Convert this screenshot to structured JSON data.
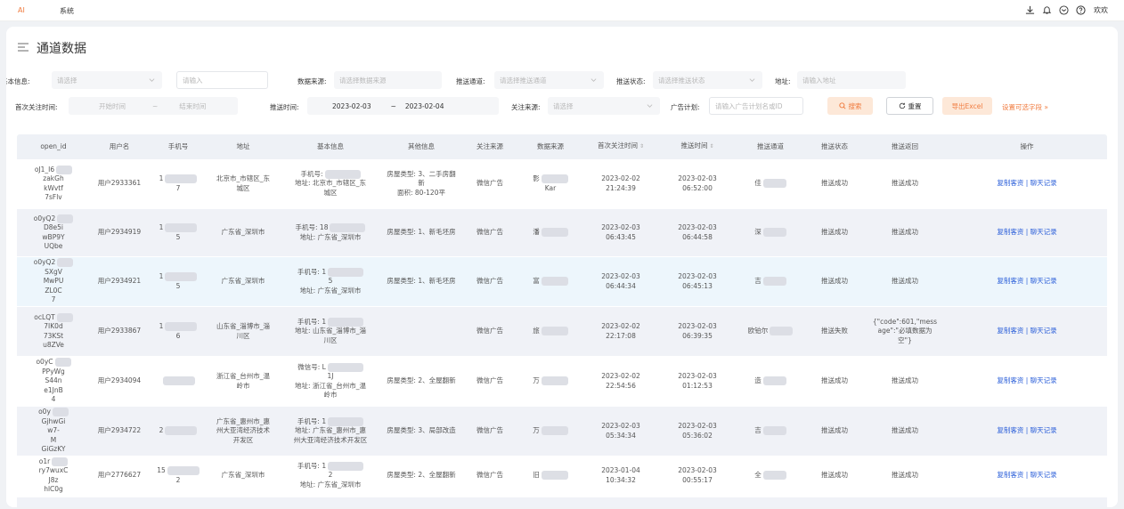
{
  "topbar": {
    "ai_tab": "AI",
    "system_tab": "系统",
    "user": "欢欢",
    "icons": [
      "download-icon",
      "bell-icon",
      "mail-icon",
      "help-icon"
    ]
  },
  "page": {
    "title": "通道数据"
  },
  "filters": {
    "basic_info_label": "基本信息:",
    "basic_info_select": "请选择",
    "basic_info_input": "请输入",
    "data_source_label": "数据来源:",
    "data_source_placeholder": "请选择数据来源",
    "push_channel_label": "推送通道:",
    "push_channel_placeholder": "请选择推送通道",
    "push_status_label": "推送状态:",
    "push_status_placeholder": "请选择推送状态",
    "address_label": "地址:",
    "address_placeholder": "请输入地址",
    "first_follow_label": "首次关注时间:",
    "start_placeholder": "开始时间",
    "range_sep": "~",
    "end_placeholder": "结束时间",
    "push_time_label": "推送时间:",
    "push_time_start": "2023-02-03",
    "push_time_end": "2023-02-04",
    "follow_source_label": "关注来源:",
    "follow_source_placeholder": "请选择",
    "ad_plan_label": "广告计划:",
    "ad_plan_placeholder": "请输入广告计划名或ID",
    "search_button": "搜索",
    "reset_button": "重置",
    "export_button": "导出Excel",
    "set_fields_link": "设置可选字段 »"
  },
  "table": {
    "headers": [
      "open_id",
      "用户名",
      "手机号",
      "地址",
      "基本信息",
      "其他信息",
      "关注来源",
      "数据来源",
      "首次关注时间",
      "推送时间",
      "推送通道",
      "推送状态",
      "推送返回",
      "操作"
    ],
    "sort_glyph": "⇕",
    "action_copy": "复制客资",
    "action_sep": "|",
    "action_chat": "聊天记录",
    "rows": [
      {
        "open_id": [
          "oJ1_I6",
          "zakGh",
          "kWvtf",
          "7sFlv"
        ],
        "user": "用户2933361",
        "phone": [
          "1",
          "7"
        ],
        "address": [
          "北京市_市辖区_东",
          "城区"
        ],
        "basic": [
          "手机号:",
          "地址: 北京市_市辖区_东",
          "城区"
        ],
        "other": [
          "房屋类型: 3、二手房翻",
          "新",
          "面积: 80-120平"
        ],
        "follow": "微信广告",
        "source": [
          "影",
          "Kar"
        ],
        "first": [
          "2023-02-02",
          "21:24:39"
        ],
        "push": [
          "2023-02-03",
          "06:52:00"
        ],
        "channel": "佳",
        "status": "推送成功",
        "ret": [
          "推送成功"
        ]
      },
      {
        "open_id": [
          "o0yQ2",
          "D8e5i",
          "wBP9Y",
          "UQbe"
        ],
        "user": "用户2934919",
        "phone": [
          "1",
          "5"
        ],
        "address": [
          "广东省_深圳市"
        ],
        "basic": [
          "手机号: 18",
          "地址: 广东省_深圳市"
        ],
        "other": [
          "房屋类型: 1、新毛坯房"
        ],
        "follow": "微信广告",
        "source": [
          "潘"
        ],
        "first": [
          "2023-02-03",
          "06:43:45"
        ],
        "push": [
          "2023-02-03",
          "06:44:58"
        ],
        "channel": "深",
        "status": "推送成功",
        "ret": [
          "推送成功"
        ]
      },
      {
        "open_id": [
          "o0yQ2",
          "SXgV",
          "MwPU",
          "ZL0C",
          "7"
        ],
        "user": "用户2934921",
        "phone": [
          "1",
          "5"
        ],
        "address": [
          "广东省_深圳市"
        ],
        "basic": [
          "手机号: 1",
          "5",
          "地址: 广东省_深圳市"
        ],
        "other": [
          "房屋类型: 1、新毛坯房"
        ],
        "follow": "微信广告",
        "source": [
          "富"
        ],
        "first": [
          "2023-02-03",
          "06:44:34"
        ],
        "push": [
          "2023-02-03",
          "06:45:13"
        ],
        "channel": "吉",
        "status": "推送成功",
        "ret": [
          "推送成功"
        ]
      },
      {
        "open_id": [
          "ocLQT",
          "7IK0d",
          "73KSt",
          "u8ZVe"
        ],
        "user": "用户2933867",
        "phone": [
          "1",
          "6"
        ],
        "address": [
          "山东省_淄博市_淄",
          "川区"
        ],
        "basic": [
          "手机号: 1",
          "地址: 山东省_淄博市_淄",
          "川区"
        ],
        "other": [
          ""
        ],
        "follow": "微信广告",
        "source": [
          "旅"
        ],
        "first": [
          "2023-02-02",
          "22:17:08"
        ],
        "push": [
          "2023-02-03",
          "06:39:35"
        ],
        "channel": "欧铂尔",
        "status": "推送失败",
        "ret": [
          "{\"code\":601,\"mess",
          "age\":\"必填数据为",
          "空\"}"
        ]
      },
      {
        "open_id": [
          "o0yC",
          "PPyWg",
          "S44n",
          "e1JnB",
          "4"
        ],
        "user": "用户2934094",
        "phone": [
          ""
        ],
        "address": [
          "浙江省_台州市_温",
          "岭市"
        ],
        "basic": [
          "微信号: L",
          "1J",
          "地址: 浙江省_台州市_温",
          "岭市"
        ],
        "other": [
          "房屋类型: 2、全屋翻新"
        ],
        "follow": "微信广告",
        "source": [
          "万"
        ],
        "first": [
          "2023-02-02",
          "22:54:56"
        ],
        "push": [
          "2023-02-03",
          "01:12:53"
        ],
        "channel": "造",
        "status": "推送成功",
        "ret": [
          "推送成功"
        ]
      },
      {
        "open_id": [
          "o0y",
          "GjhwGi",
          "w7-",
          "M",
          "GiGzKY"
        ],
        "user": "用户2934722",
        "phone": [
          "2"
        ],
        "address": [
          "广东省_惠州市_惠",
          "州大亚湾经济技术",
          "开发区"
        ],
        "basic": [
          "手机号: 1",
          "地址: 广东省_惠州市_惠",
          "州大亚湾经济技术开发区"
        ],
        "other": [
          "房屋类型: 3、局部改造"
        ],
        "follow": "微信广告",
        "source": [
          "万"
        ],
        "first": [
          "2023-02-03",
          "05:34:34"
        ],
        "push": [
          "2023-02-03",
          "05:36:02"
        ],
        "channel": "吉",
        "status": "推送成功",
        "ret": [
          "推送成功"
        ]
      },
      {
        "open_id": [
          "o1r",
          "ry7wuxC",
          "J8z",
          "hlC0g"
        ],
        "user": "用户2776627",
        "phone": [
          "15",
          "2"
        ],
        "address": [
          "广东省_深圳市"
        ],
        "basic": [
          "手机号: 1",
          "2",
          "地址: 广东省_深圳市"
        ],
        "other": [
          "房屋类型: 2、全屋翻新"
        ],
        "follow": "微信广告",
        "source": [
          "旧"
        ],
        "first": [
          "2023-01-04",
          "10:34:32"
        ],
        "push": [
          "2023-02-03",
          "00:55:17"
        ],
        "channel": "全",
        "status": "推送成功",
        "ret": [
          "推送成功"
        ]
      }
    ]
  }
}
